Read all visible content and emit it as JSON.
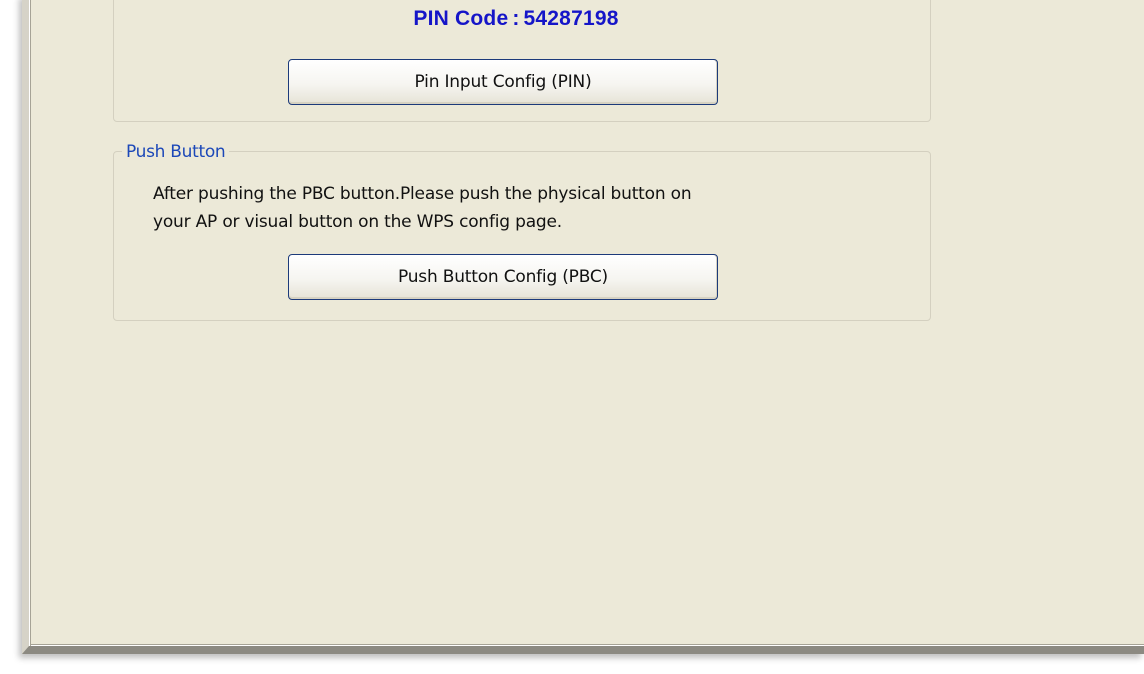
{
  "pin_section": {
    "pin_code_label": "PIN Code",
    "pin_code_separator": ":",
    "pin_code_value": "54287198",
    "pin_button_label": "Pin Input Config (PIN)"
  },
  "push_button_section": {
    "title": "Push Button",
    "description_line1": "After pushing the PBC button.Please push the physical button on",
    "description_line2": "your AP or visual button on the WPS config page.",
    "pbc_button_label": "Push Button Config (PBC)"
  },
  "colors": {
    "window_background": "#ece9d8",
    "pin_code_text": "#1515c8",
    "group_title_text": "#1c48b8",
    "button_border": "#1c3a7a"
  }
}
